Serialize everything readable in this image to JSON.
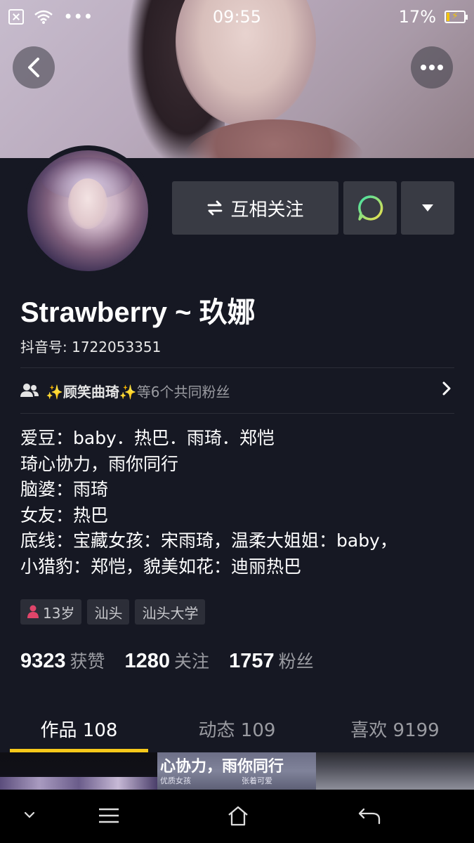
{
  "status_bar": {
    "time": "09:55",
    "battery_percent": "17%",
    "dots": "•••",
    "icons": [
      "close-box-icon",
      "wifi-icon",
      "battery-charging-icon"
    ]
  },
  "header": {
    "back_icon": "chevron-left-icon",
    "more_icon": "more-horizontal-icon"
  },
  "profile": {
    "name": "Strawberry ~ 玖娜",
    "douyin_id": "抖音号: 1722053351",
    "follow_button_label": "互相关注",
    "follow_icon": "swap-arrows-icon",
    "message_icon": "chat-bubble-icon",
    "dropdown_icon": "triangle-down-icon"
  },
  "common_fans": {
    "highlight": "✨顾笑曲琦✨",
    "rest": "等6个共同粉丝",
    "icon": "users-icon"
  },
  "bio": [
    "爱豆：baby．热巴．雨琦．郑恺",
    "琦心协力，雨你同行",
    "脑婆：雨琦",
    "女友：热巴",
    "底线：宝藏女孩：宋雨琦，温柔大姐姐：baby，",
    "小猎豹：郑恺，貌美如花：迪丽热巴"
  ],
  "tags": [
    {
      "label": "13岁",
      "icon": "female-user-icon"
    },
    {
      "label": "汕头"
    },
    {
      "label": "汕头大学"
    }
  ],
  "stats": [
    {
      "num": "9323",
      "label": "获赞"
    },
    {
      "num": "1280",
      "label": "关注"
    },
    {
      "num": "1757",
      "label": "粉丝"
    }
  ],
  "tabs": [
    {
      "label": "作品 108",
      "active": true
    },
    {
      "label": "动态 109"
    },
    {
      "label": "喜欢 9199"
    }
  ],
  "thumb_text": {
    "title": "心协力，雨你同行",
    "sub1": "优质女孩",
    "sub2": "张着可爱"
  },
  "navbar": {
    "icons": [
      "chevron-down-icon",
      "menu-icon",
      "home-icon",
      "back-arrow-icon"
    ]
  },
  "colors": {
    "background": "#161823",
    "button": "#393b44",
    "tab_indicator": "#f6c81a",
    "message_icon_gradient": [
      "#3ee0a6",
      "#f1e04a"
    ]
  }
}
